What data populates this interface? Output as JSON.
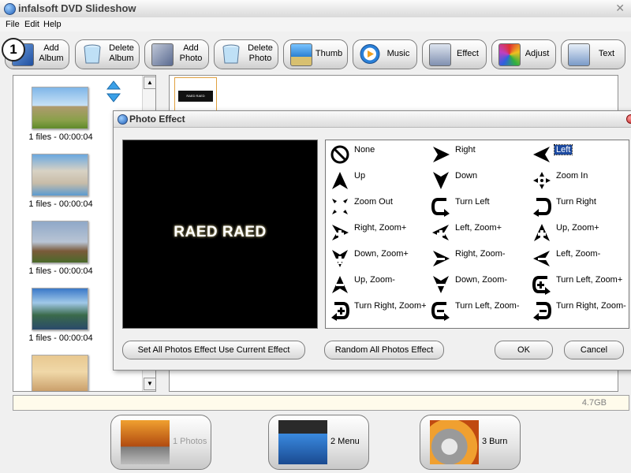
{
  "app": {
    "title": "infalsoft DVD Slideshow"
  },
  "menu": [
    "File",
    "Edit",
    "Help"
  ],
  "step_badge": "1",
  "toolbar": [
    {
      "id": "add-album",
      "label": [
        "Add",
        "Album"
      ],
      "icon": "add-album-icon"
    },
    {
      "id": "delete-album",
      "label": [
        "Delete",
        "Album"
      ],
      "icon": "trash-icon"
    },
    {
      "id": "add-photo",
      "label": [
        "Add",
        "Photo"
      ],
      "icon": "add-photo-icon"
    },
    {
      "id": "delete-photo",
      "label": [
        "Delete",
        "Photo"
      ],
      "icon": "trash-icon"
    },
    {
      "id": "thumb",
      "label": [
        "Thumb"
      ],
      "icon": "thumbnail-icon"
    },
    {
      "id": "music",
      "label": [
        "Music"
      ],
      "icon": "music-icon"
    },
    {
      "id": "effect",
      "label": [
        "Effect"
      ],
      "icon": "effect-icon"
    },
    {
      "id": "adjust",
      "label": [
        "Adjust"
      ],
      "icon": "adjust-icon"
    },
    {
      "id": "text",
      "label": [
        "Text"
      ],
      "icon": "text-icon"
    }
  ],
  "albums": [
    {
      "caption": "1 files - 00:00:04"
    },
    {
      "caption": "1 files - 00:00:04"
    },
    {
      "caption": "1 files - 00:00:04"
    },
    {
      "caption": "1 files - 00:00:04"
    },
    {
      "caption": ""
    }
  ],
  "photo_panel": {
    "mini_text": "RAED RAED"
  },
  "storage": {
    "capacity_label": "4.7GB"
  },
  "bottom_nav": [
    {
      "id": "photos",
      "label": "1 Photos",
      "icon": "photos-camera-icon",
      "active": false
    },
    {
      "id": "menu",
      "label": "2 Menu",
      "icon": "clapperboard-icon",
      "active": true
    },
    {
      "id": "burn",
      "label": "3 Burn",
      "icon": "burn-disc-icon",
      "active": true
    }
  ],
  "dialog": {
    "title": "Photo Effect",
    "preview_text": "RAED RAED",
    "effects": [
      "None",
      "Right",
      "Left",
      "Up",
      "Down",
      "Zoom In",
      "Zoom Out",
      "Turn Left",
      "Turn Right",
      "Right, Zoom+",
      "Left, Zoom+",
      "Up, Zoom+",
      "Down, Zoom+",
      "Right, Zoom-",
      "Left, Zoom-",
      "Up, Zoom-",
      "Down, Zoom-",
      "Turn Left, Zoom+",
      "Turn Right, Zoom+",
      "Turn Left, Zoom-",
      "Turn Right, Zoom-"
    ],
    "selected_effect": "Left",
    "buttons": {
      "set_all": "Set All Photos Effect Use Current Effect",
      "random_all": "Random All Photos Effect",
      "ok": "OK",
      "cancel": "Cancel"
    }
  }
}
